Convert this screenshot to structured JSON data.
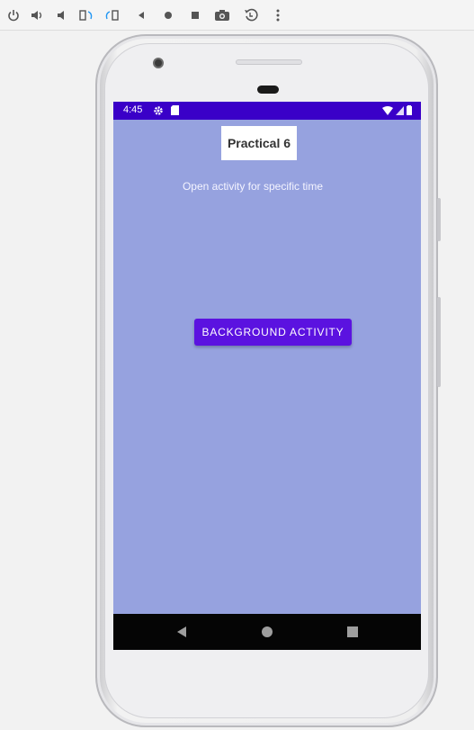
{
  "emulator_toolbar": {
    "icons": [
      "power-icon",
      "volume-up-icon",
      "volume-down-icon",
      "rotate-left-icon",
      "rotate-right-icon",
      "back-icon",
      "home-icon",
      "overview-icon",
      "camera-icon",
      "replay-icon",
      "more-icon"
    ]
  },
  "status_bar": {
    "time": "4:45",
    "left_icons": [
      "settings-icon",
      "sd-card-icon"
    ],
    "right_icons": [
      "wifi-icon",
      "signal-icon",
      "battery-icon"
    ],
    "color": "#3a00c8"
  },
  "app": {
    "background_color": "#96a2df",
    "title": "Practical 6",
    "subtitle": "Open activity for specific time",
    "button_label": "BACKGROUND ACTIVITY",
    "button_color": "#5b12e0"
  },
  "nav_bar": {
    "buttons": [
      "nav-back-icon",
      "nav-home-icon",
      "nav-recents-icon"
    ]
  }
}
